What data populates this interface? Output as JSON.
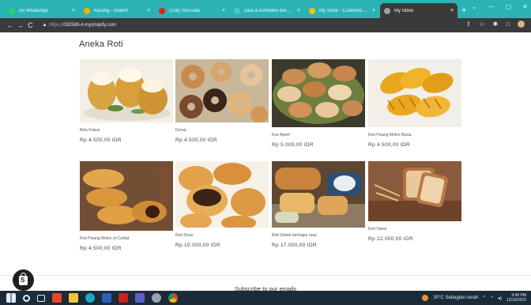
{
  "browser": {
    "tabs": [
      {
        "title": "(4) WhatsApp",
        "fav_color": "#25d366",
        "active": false
      },
      {
        "title": "Kerang - shabrn",
        "fav_color": "#f4b400",
        "active": false
      },
      {
        "title": "(128) YouTube",
        "fav_color": "#e62117",
        "active": false
      },
      {
        "title": "cara a combatre berbage",
        "fav_color": "#4cc9c9",
        "active": false
      },
      {
        "title": "My Store · Customize Sto",
        "fav_color": "#f4c20d",
        "active": false
      },
      {
        "title": "My Store",
        "fav_color": "#9aa0a6",
        "active": true
      }
    ],
    "close_glyph": "×",
    "new_tab_glyph": "+",
    "window_controls": [
      "⌄",
      "—",
      "▢",
      "✕"
    ],
    "url_protocol": "https://",
    "url_host": "092589-4.myshopify.com",
    "nav": {
      "back": "←",
      "forward": "→",
      "reload": "C"
    },
    "toolbar_glyphs": [
      "⇪",
      "☆",
      "✱",
      "□"
    ]
  },
  "page": {
    "section_title": "Aneka Roti",
    "products": [
      {
        "name": "Bolu Kukus",
        "price": "Rp 4.500,00 IDR",
        "icon": "bolu-kukus-image"
      },
      {
        "name": "Donat",
        "price": "Rp 4.500,00 IDR",
        "icon": "donut-image"
      },
      {
        "name": "Kue Apem",
        "price": "Rp 5.000,00 IDR",
        "icon": "kue-apem-image"
      },
      {
        "name": "Roti Pisang Molen Biasa",
        "price": "Rp 4.500,00 IDR",
        "icon": "molen-image"
      },
      {
        "name": "Roti Pisang Molen isi Coklat",
        "price": "Rp 4.500,00 IDR",
        "icon": "molen-coklat-image"
      },
      {
        "name": "Roti Sosis",
        "price": "Rp 10.000,00 IDR",
        "icon": "roti-sosis-image"
      },
      {
        "name": "Roti Sobek berbagai rasa",
        "price": "Rp 17.000,00 IDR",
        "icon": "roti-sobek-image"
      },
      {
        "name": "Roti Tawar",
        "price": "Rp 12.000,00 IDR",
        "icon": "roti-tawar-image"
      }
    ],
    "subscribe_heading": "Subscribe to our emails"
  },
  "taskbar": {
    "weather": "30°C Sebagian cerah",
    "time": "9:45 PM",
    "date": "12/19/2022",
    "icons": [
      "windows-start-icon",
      "search-icon",
      "task-view-icon",
      "office-icon",
      "file-explorer-icon",
      "edge-icon",
      "word-icon",
      "acrobat-icon",
      "teams-icon",
      "settings-icon",
      "chrome-icon"
    ]
  }
}
